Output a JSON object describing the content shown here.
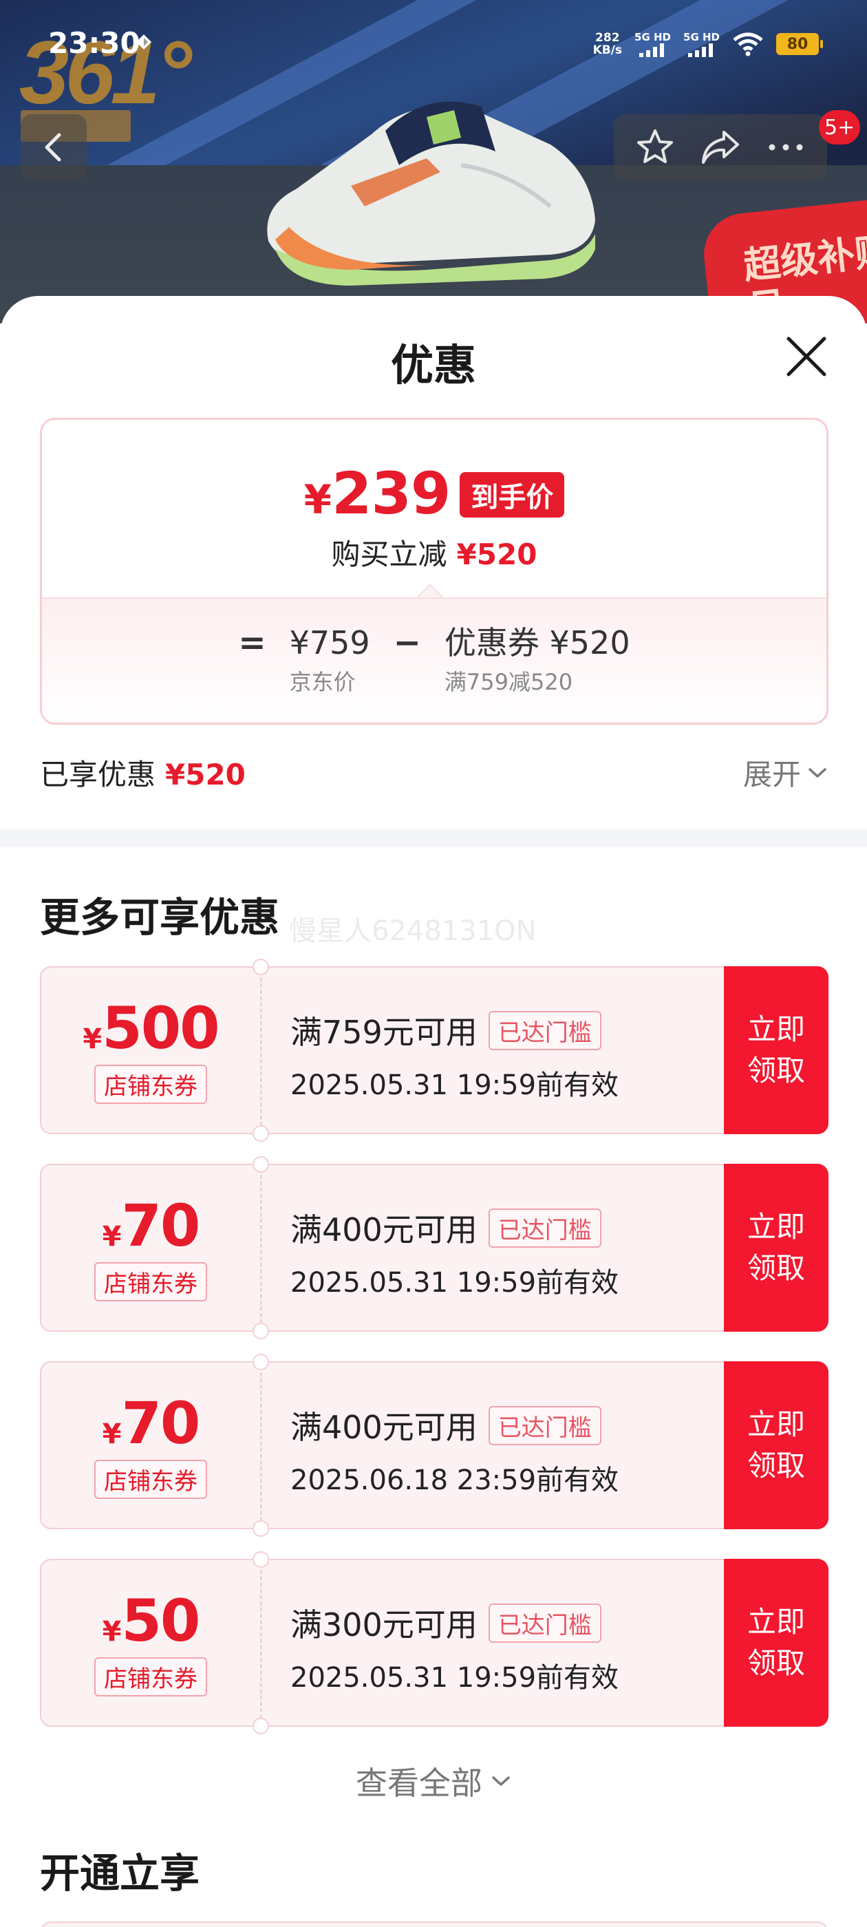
{
  "status_bar": {
    "time": "23:30",
    "net_speed_value": "282",
    "net_speed_unit": "KB/s",
    "signal_1": "5G HD",
    "signal_2": "5G HD",
    "battery": "80"
  },
  "banner": {
    "brand_logo_text": "361°",
    "promo_tag_text": "超级补贴日",
    "message_badge": "5+"
  },
  "sheet": {
    "title": "优惠",
    "summary": {
      "final_yen": "¥",
      "final_price": "239",
      "final_tag": "到手价",
      "instant_label": "购买立减",
      "instant_amount": "¥520",
      "equals": "=",
      "minus": "−",
      "jd_price": "¥759",
      "jd_price_label": "京东价",
      "coupon_label": "优惠券 ¥520",
      "coupon_rule": "满759减520"
    },
    "enjoyed_label": "已享优惠",
    "enjoyed_amount": "¥520",
    "expand_label": "展开",
    "more_title": "更多可享优惠",
    "watermark": "慢星人6248131ON",
    "coupons": [
      {
        "yen": "¥",
        "value": "500",
        "type": "店铺东券",
        "condition": "满759元可用",
        "status": "已达门槛",
        "expiry": "2025.05.31 19:59前有效",
        "action": "立即领取"
      },
      {
        "yen": "¥",
        "value": "70",
        "type": "店铺东券",
        "condition": "满400元可用",
        "status": "已达门槛",
        "expiry": "2025.05.31 19:59前有效",
        "action": "立即领取"
      },
      {
        "yen": "¥",
        "value": "70",
        "type": "店铺东券",
        "condition": "满400元可用",
        "status": "已达门槛",
        "expiry": "2025.06.18 23:59前有效",
        "action": "立即领取"
      },
      {
        "yen": "¥",
        "value": "50",
        "type": "店铺东券",
        "condition": "满300元可用",
        "status": "已达门槛",
        "expiry": "2025.05.31 19:59前有效",
        "action": "立即领取"
      }
    ],
    "view_all_label": "查看全部",
    "open_title": "开通立享"
  },
  "colors": {
    "accent_red": "#e61b2b",
    "claim_red": "#f3172f",
    "coupon_bg": "#fdf2f3"
  },
  "icons": [
    "back-icon",
    "star-icon",
    "share-icon",
    "more-icon",
    "close-icon",
    "chevron-down-icon"
  ]
}
